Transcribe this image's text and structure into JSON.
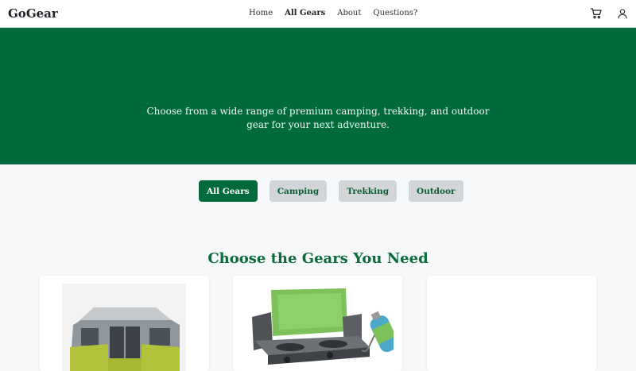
{
  "nav": {
    "brand": "GoGear",
    "links": [
      {
        "label": "Home",
        "active": false
      },
      {
        "label": "All Gears",
        "active": true
      },
      {
        "label": "About",
        "active": false
      },
      {
        "label": "Questions?",
        "active": false
      }
    ],
    "icons": [
      "cart-icon",
      "user-icon"
    ]
  },
  "hero": {
    "text": "Choose from a wide range of premium camping, trekking, and outdoor gear for your next adventure.",
    "color": "#006a3a"
  },
  "filters": [
    {
      "label": "All Gears",
      "active": true
    },
    {
      "label": "Camping",
      "active": false
    },
    {
      "label": "Trekking",
      "active": false
    },
    {
      "label": "Outdoor",
      "active": false
    }
  ],
  "section": {
    "title": "Choose the Gears You Need"
  },
  "products": [
    {
      "image": "tent-image"
    },
    {
      "image": "camping-stove-image"
    },
    {
      "image": ""
    }
  ],
  "colors": {
    "accent": "#006a3a",
    "title": "#0b6b3b",
    "background": "#f6f8fa"
  }
}
